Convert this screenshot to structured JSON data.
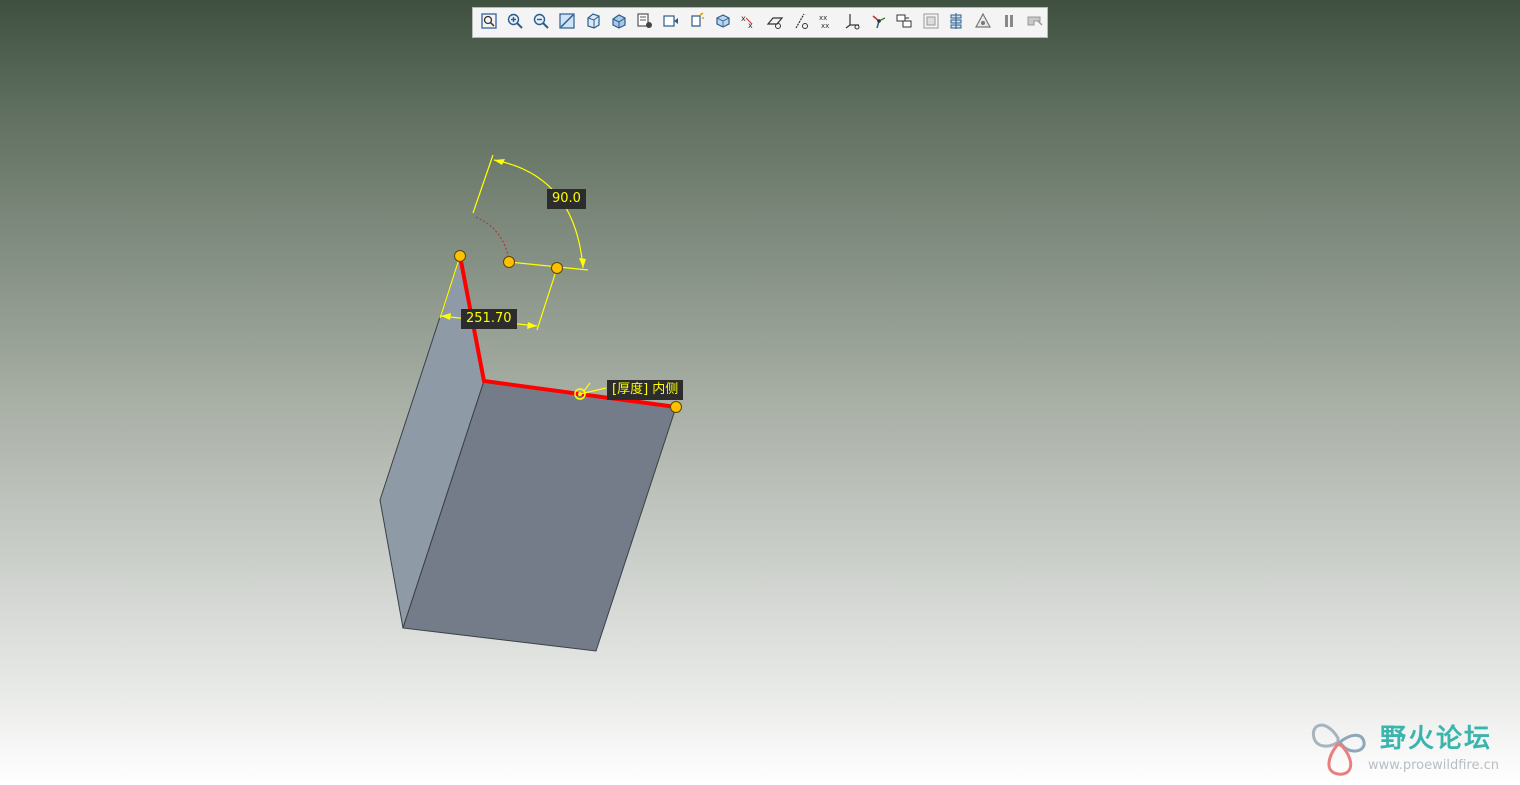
{
  "toolbar": {
    "buttons": [
      {
        "name": "refit-icon"
      },
      {
        "name": "zoom-in-icon"
      },
      {
        "name": "zoom-out-icon"
      },
      {
        "name": "repaint-icon"
      },
      {
        "name": "saved-orientations-icon"
      },
      {
        "name": "display-style-icon"
      },
      {
        "name": "view-manager-icon"
      },
      {
        "name": "sketch-view-icon"
      },
      {
        "name": "section-icon"
      },
      {
        "name": "annotation-display-icon"
      },
      {
        "name": "point-display-icon"
      },
      {
        "name": "plane-display-icon"
      },
      {
        "name": "axis-display-icon"
      },
      {
        "name": "point-tag-display-icon"
      },
      {
        "name": "csys-display-icon"
      },
      {
        "name": "spin-center-icon"
      },
      {
        "name": "datum-display-filters-icon"
      },
      {
        "name": "annotation-filters-icon"
      },
      {
        "name": "layer-icon"
      },
      {
        "name": "sketcher-display-icon"
      },
      {
        "name": "pause-icon"
      },
      {
        "name": "exit-icon"
      }
    ]
  },
  "dimensions": {
    "angle": "90.0",
    "length": "251.70"
  },
  "tag": {
    "text": "[厚度] 内侧"
  },
  "watermark": {
    "title": "野火论坛",
    "url": "www.proewildfire.cn"
  },
  "colors": {
    "sketch_line": "#ff0000",
    "dimension": "#ffff00",
    "handle_fill": "#ffc000",
    "face_left": "#8e9aa6",
    "face_front": "#757c89",
    "watermark_text": "#39b5ad"
  }
}
